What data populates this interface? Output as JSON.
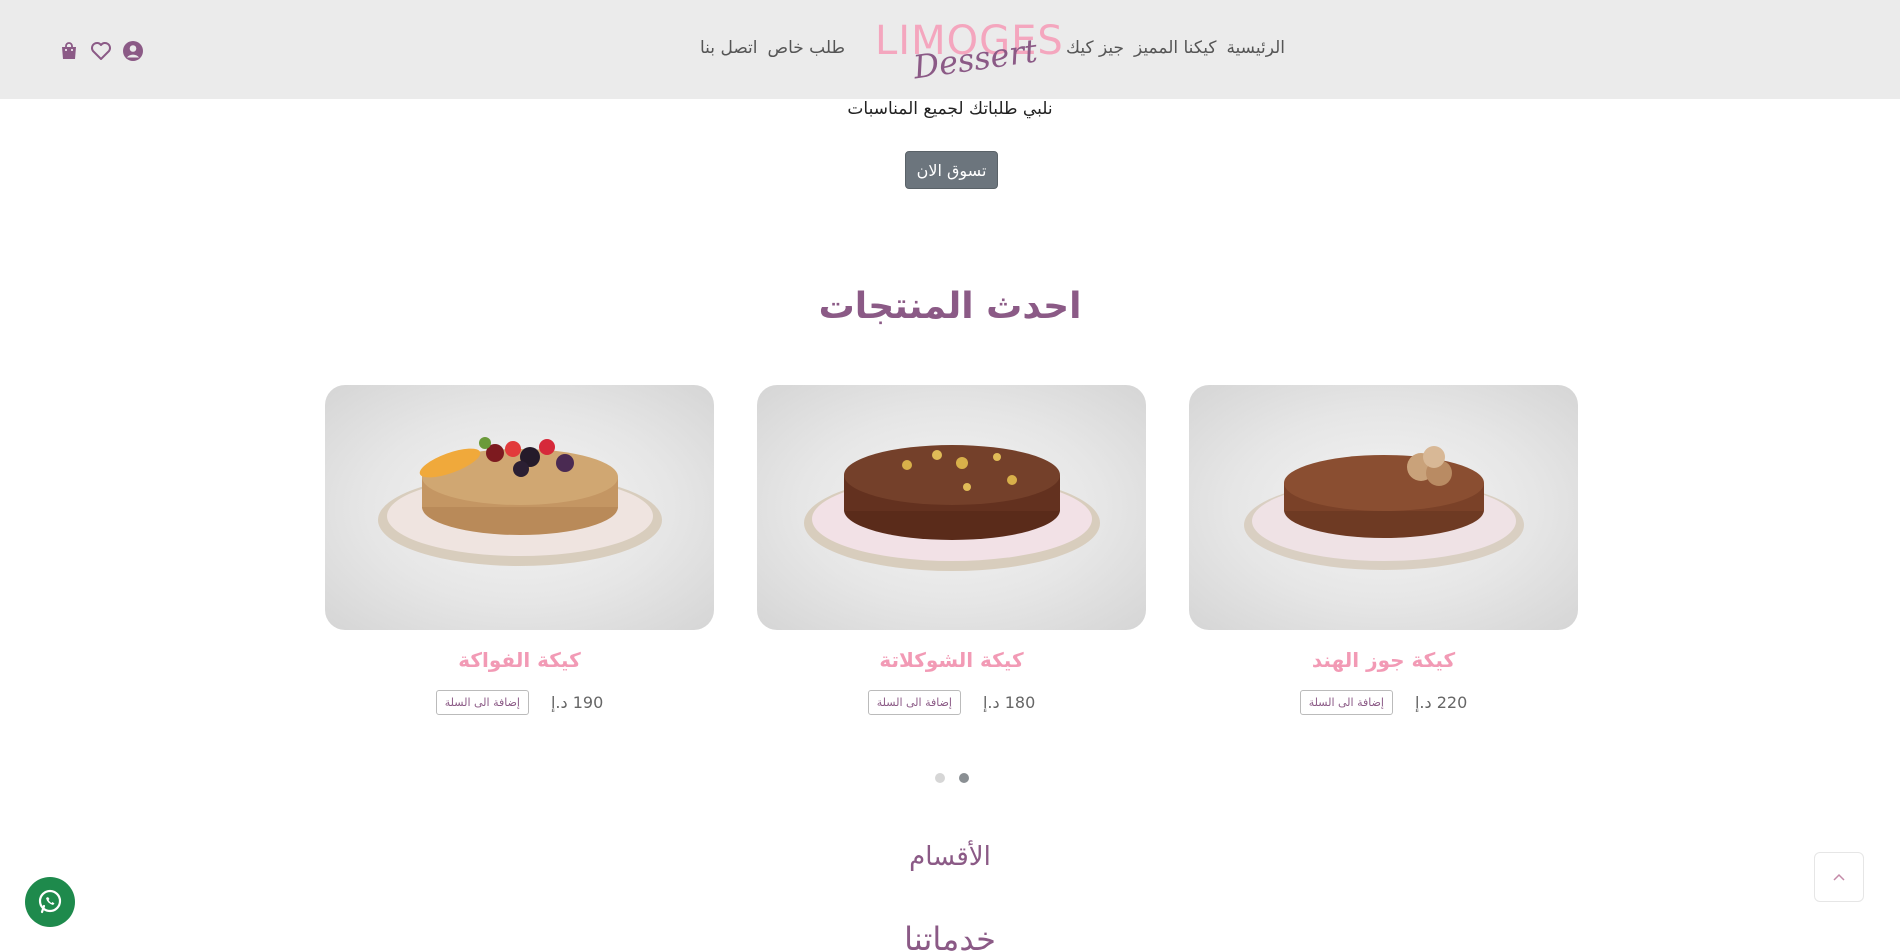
{
  "nav": {
    "right_items": [
      "الرئيسية",
      "كيكنا المميز",
      "جيز كيك"
    ],
    "left_items": [
      "طلب خاص",
      "اتصل بنا"
    ]
  },
  "logo": {
    "main": "LIMOGES",
    "script": "Dessert"
  },
  "header_icons": [
    "user-icon",
    "heart-icon",
    "shopping-bag-icon"
  ],
  "hero": {
    "tagline": "نلبي طلباتك لجميع المناسبات",
    "cta_label": "تسوق الان"
  },
  "latest": {
    "title": "احدث المنتجات",
    "products": [
      {
        "name": "كيكة جوز الهند",
        "price": "220 د.إ",
        "add_label": "إضافة الى السلة"
      },
      {
        "name": "كيكة الشوكلاتة",
        "price": "180 د.إ",
        "add_label": "إضافة الى السلة"
      },
      {
        "name": "كيكة الفواكة",
        "price": "190 د.إ",
        "add_label": "إضافة الى السلة"
      }
    ]
  },
  "carousel": {
    "pages": 2,
    "active_index": 0
  },
  "sections": {
    "categories_title": "الأقسام",
    "services_title": "خدماتنا"
  },
  "colors": {
    "brand_purple": "#8b5a86",
    "brand_pink": "#f29ab5",
    "header_bg": "#ebebeb",
    "whatsapp_green": "#1e8a4c"
  }
}
